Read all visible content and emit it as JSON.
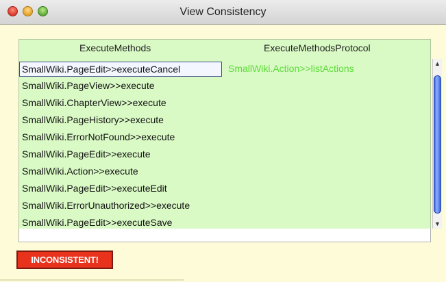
{
  "window": {
    "title": "View Consistency"
  },
  "columns": {
    "left_header": "ExecuteMethods",
    "right_header": "ExecuteMethodsProtocol"
  },
  "execute_methods": [
    "SmallWiki.PageEdit>>executeCancel",
    "SmallWiki.PageView>>execute",
    "SmallWiki.ChapterView>>execute",
    "SmallWiki.PageHistory>>execute",
    "SmallWiki.ErrorNotFound>>execute",
    "SmallWiki.PageEdit>>execute",
    "SmallWiki.Action>>execute",
    "SmallWiki.PageEdit>>executeEdit",
    "SmallWiki.ErrorUnauthorized>>execute",
    "SmallWiki.PageEdit>>executeSave"
  ],
  "execute_methods_protocol": [
    "SmallWiki.Action>>listActions"
  ],
  "status": {
    "label": "INCONSISTENT!",
    "color": "#e8321c"
  },
  "colors": {
    "panel_bg": "#d9f9c5",
    "window_bg": "#fdfbd8",
    "protocol_text": "#5ddc3a"
  }
}
